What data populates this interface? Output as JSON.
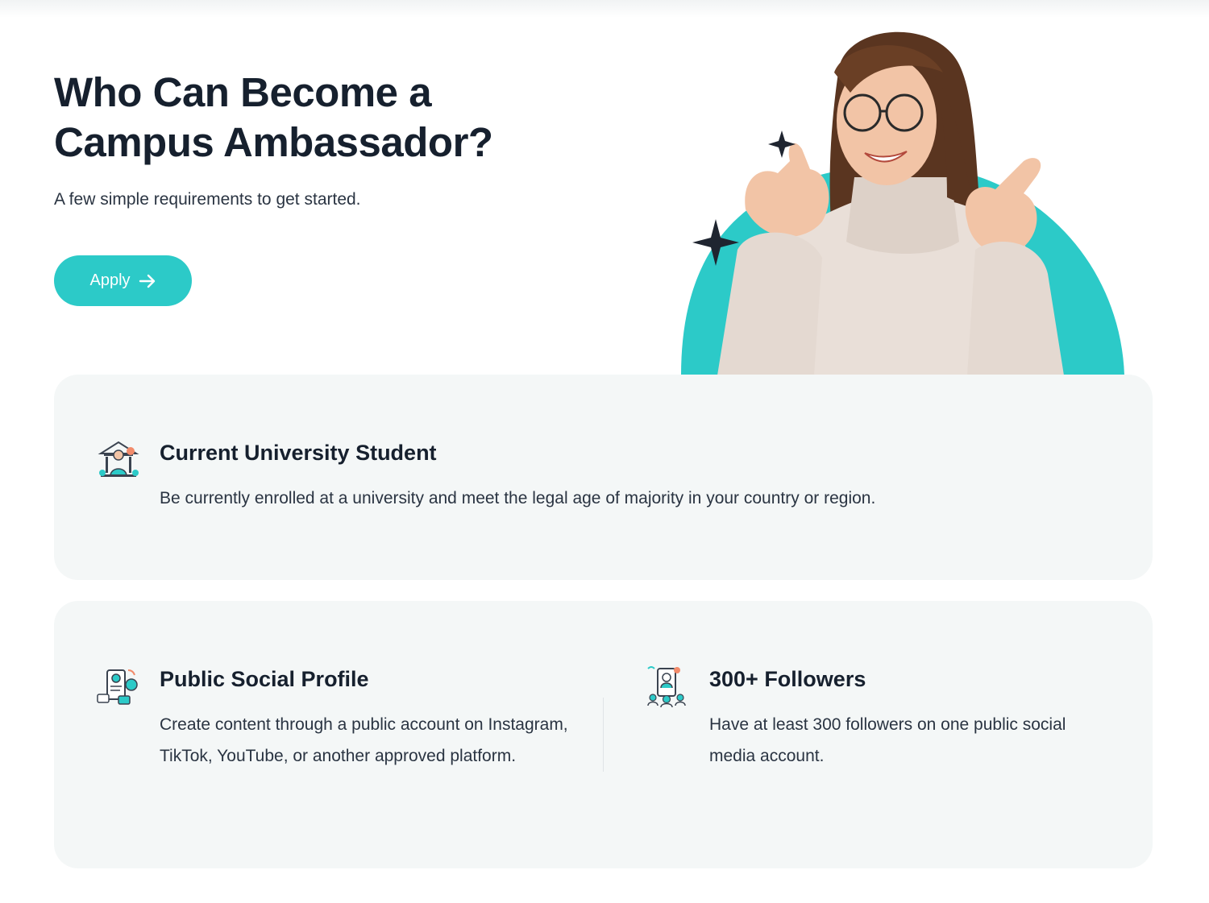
{
  "hero": {
    "title_line1": "Who Can Become a",
    "title_line2": "Campus Ambassador?",
    "subtitle": "A few simple requirements to get started.",
    "apply_label": "Apply"
  },
  "requirements": [
    {
      "title": "Current University Student",
      "description": "Be currently enrolled at a university and meet the legal age of majority in your country or region.",
      "icon": "university-student-icon"
    },
    {
      "title": "Public Social Profile",
      "description": "Create content through a public account on Instagram, TikTok, YouTube, or another approved platform.",
      "icon": "social-profile-icon"
    },
    {
      "title": "300+ Followers",
      "description": "Have at least 300 followers on one public social media account.",
      "icon": "followers-icon"
    }
  ],
  "colors": {
    "accent": "#2ccac8",
    "heading": "#16202e",
    "body": "#2a3442",
    "card_bg": "#f4f7f7"
  }
}
